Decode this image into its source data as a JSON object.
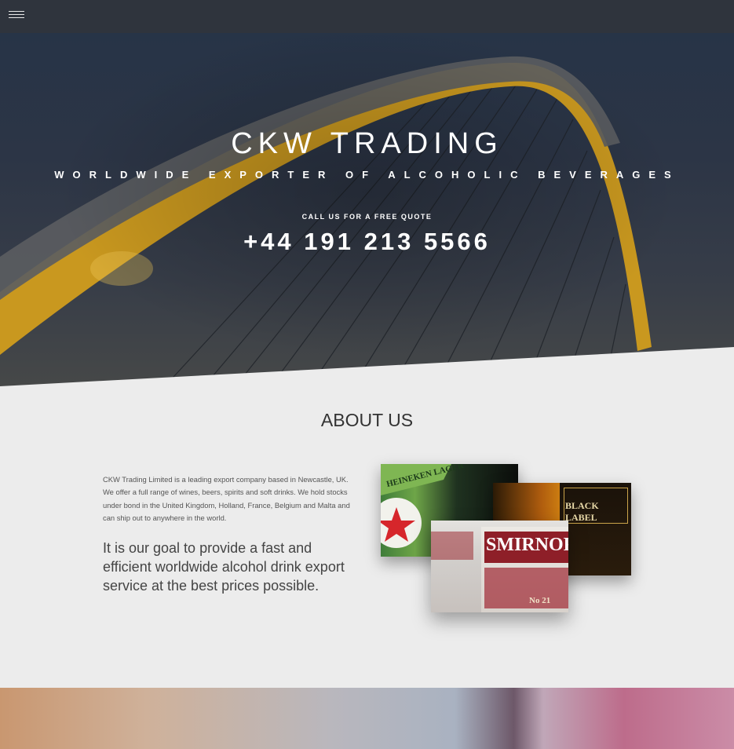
{
  "nav": {
    "menu_icon": "hamburger-icon"
  },
  "hero": {
    "title": "CKW TRADING",
    "subtitle": "WORLDWIDE EXPORTER OF ALCOHOLIC BEVERAGES",
    "cta_label": "CALL US FOR A FREE QUOTE",
    "phone": "+44 191 213 5566"
  },
  "about": {
    "heading": "ABOUT US",
    "description": "CKW Trading Limited is a leading export company based in Newcastle, UK. We offer a full range of wines, beers, spirits and soft drinks. We hold stocks under bond in the United Kingdom, Holland, France, Belgium and Malta and can ship out to anywhere in the world.",
    "goal": "It is our goal to provide a fast and efficient worldwide alcohol drink export service at the best prices possible.",
    "photos": {
      "heineken": "HEINEKEN LAGER",
      "johnnie": "BLACK LABEL",
      "smirnoff": "SMIRNOFF",
      "smirnoff_no": "No 21"
    }
  },
  "colors": {
    "topbar": "#2f343d",
    "page_bg": "#ececec",
    "bridge_arch": "#d3a12a"
  }
}
